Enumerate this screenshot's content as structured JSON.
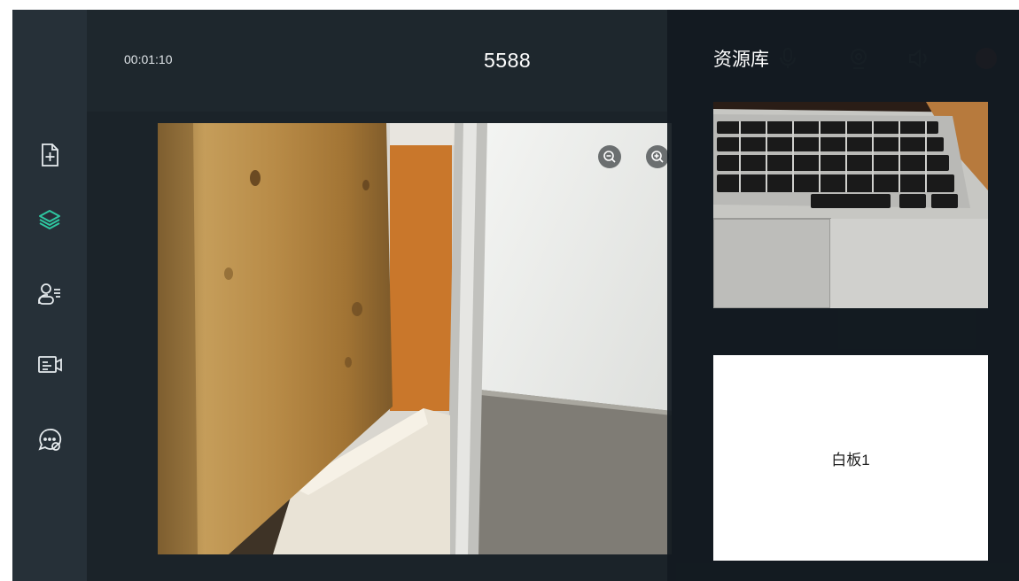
{
  "header": {
    "timer": "00:01:10",
    "room_id": "5588"
  },
  "sidebar": {
    "items": [
      {
        "name": "add-document",
        "icon": "file-plus-icon"
      },
      {
        "name": "resource-library",
        "icon": "layers-icon",
        "active": true
      },
      {
        "name": "member-list",
        "icon": "user-list-icon"
      },
      {
        "name": "video-list",
        "icon": "video-list-icon"
      },
      {
        "name": "chat-mute",
        "icon": "chat-mute-icon"
      }
    ]
  },
  "toolbar": {
    "icons": [
      "microphone-icon",
      "camera-icon",
      "speaker-icon",
      "exit-icon"
    ]
  },
  "video": {
    "zoom_out_icon": "zoom-out-icon",
    "zoom_in_icon": "zoom-in-icon"
  },
  "resource_panel": {
    "title": "资源库",
    "items": [
      {
        "type": "camera-snapshot"
      },
      {
        "type": "whiteboard",
        "label": "白板1"
      }
    ]
  },
  "colors": {
    "accent": "#2ec6a0",
    "background": "#1b2329",
    "rail": "#263038"
  }
}
